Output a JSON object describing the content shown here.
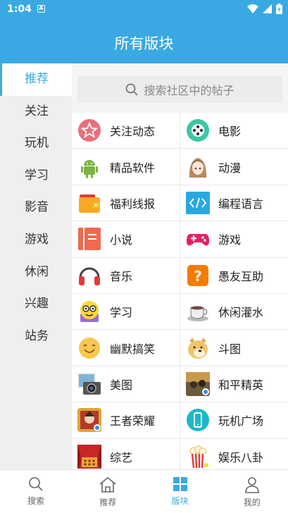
{
  "status_bar": {
    "time": "1:04",
    "notif_letter": "A"
  },
  "header": {
    "title": "所有版块"
  },
  "sidebar": {
    "items": [
      {
        "label": "推荐",
        "active": true
      },
      {
        "label": "关注"
      },
      {
        "label": "玩机"
      },
      {
        "label": "学习"
      },
      {
        "label": "影音"
      },
      {
        "label": "游戏"
      },
      {
        "label": "休闲"
      },
      {
        "label": "兴趣"
      },
      {
        "label": "站务"
      }
    ]
  },
  "search": {
    "placeholder": "搜索社区中的帖子"
  },
  "boards": [
    {
      "label": "关注动态",
      "icon": "star-circle-icon"
    },
    {
      "label": "电影",
      "icon": "film-reel-icon"
    },
    {
      "label": "精品软件",
      "icon": "android-icon"
    },
    {
      "label": "动漫",
      "icon": "anime-girl-icon"
    },
    {
      "label": "福利线报",
      "icon": "wallet-icon"
    },
    {
      "label": "编程语言",
      "icon": "code-icon"
    },
    {
      "label": "小说",
      "icon": "book-icon"
    },
    {
      "label": "游戏",
      "icon": "gamepad-icon"
    },
    {
      "label": "音乐",
      "icon": "headphones-icon"
    },
    {
      "label": "愚友互助",
      "icon": "question-icon"
    },
    {
      "label": "学习",
      "icon": "nerd-face-icon"
    },
    {
      "label": "休闲灌水",
      "icon": "coffee-cup-icon"
    },
    {
      "label": "幽默搞笑",
      "icon": "smiley-icon"
    },
    {
      "label": "斗图",
      "icon": "doge-icon"
    },
    {
      "label": "美图",
      "icon": "photo-camera-icon"
    },
    {
      "label": "和平精英",
      "icon": "game-poster-icon"
    },
    {
      "label": "王者荣耀",
      "icon": "game-hero-icon"
    },
    {
      "label": "玩机广场",
      "icon": "phone-icon"
    },
    {
      "label": "综艺",
      "icon": "stage-curtain-icon"
    },
    {
      "label": "娱乐八卦",
      "icon": "popcorn-icon"
    }
  ],
  "bottom_nav": [
    {
      "label": "搜索",
      "icon": "search-icon"
    },
    {
      "label": "推荐",
      "icon": "home-icon"
    },
    {
      "label": "版块",
      "icon": "grid-icon",
      "active": true
    },
    {
      "label": "我的",
      "icon": "person-icon"
    }
  ],
  "colors": {
    "brand": "#3aa9e3",
    "sidebar_bg": "#efefef"
  }
}
